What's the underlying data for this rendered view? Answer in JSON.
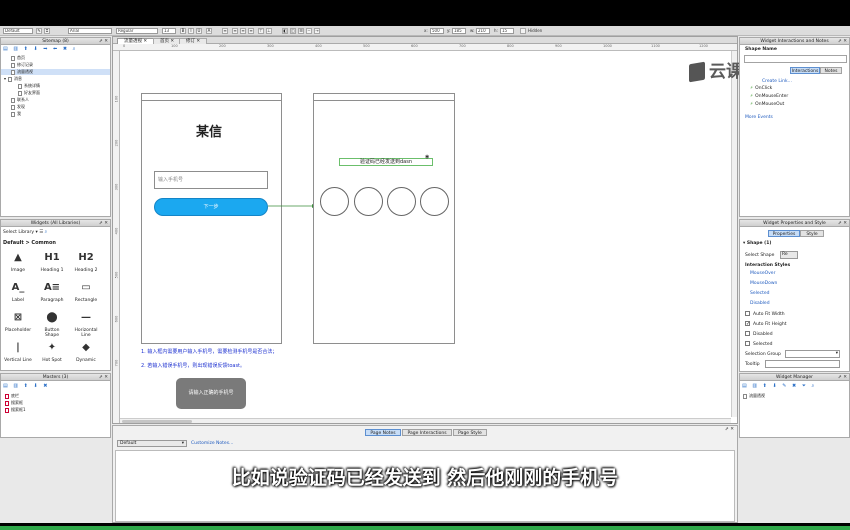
{
  "toolbar": {
    "style_select": "Default",
    "font_select": "Arial",
    "weight_select": "Regular",
    "size_select": "13",
    "x_label": "x:",
    "x_value": "500",
    "y_label": "y:",
    "y_value": "185",
    "w_label": "w:",
    "w_value": "210",
    "h_label": "h:",
    "h_value": "15",
    "hidden_label": "Hidden"
  },
  "sitemap": {
    "title": "Sitemap (8)",
    "items": [
      {
        "label": "首页",
        "indent": 1
      },
      {
        "label": "修订记录",
        "indent": 1
      },
      {
        "label": "流量透视",
        "indent": 1,
        "selected": true
      },
      {
        "label": "消息",
        "indent": 0
      },
      {
        "label": "系统详情",
        "indent": 2
      },
      {
        "label": "好友界面",
        "indent": 2
      },
      {
        "label": "联系人",
        "indent": 1
      },
      {
        "label": "发现",
        "indent": 1
      },
      {
        "label": "我",
        "indent": 1
      }
    ]
  },
  "widgets": {
    "title": "Widgets (All Libraries)",
    "select_library": "Select Library",
    "group_title": "Default > Common",
    "items": [
      {
        "label": "Image",
        "glyph": "▲"
      },
      {
        "label": "Heading 1",
        "glyph": "H1"
      },
      {
        "label": "Heading 2",
        "glyph": "H2"
      },
      {
        "label": "Label",
        "glyph": "A_"
      },
      {
        "label": "Paragraph",
        "glyph": "A≡"
      },
      {
        "label": "Rectangle",
        "glyph": "▭"
      },
      {
        "label": "Placeholder",
        "glyph": "⊠"
      },
      {
        "label": "Button Shape",
        "glyph": "⬤"
      },
      {
        "label": "Horizontal Line",
        "glyph": "—"
      },
      {
        "label": "Vertical Line",
        "glyph": "|"
      },
      {
        "label": "Hot Spot",
        "glyph": "✦"
      },
      {
        "label": "Dynamic",
        "glyph": "◆"
      }
    ]
  },
  "masters": {
    "title": "Masters (3)",
    "items": [
      "底栏",
      "搜索框",
      "搜索框1"
    ]
  },
  "tabs": {
    "active_page": "流量透视",
    "page2": "首页",
    "page3": "修订"
  },
  "ruler_ticks": [
    "0",
    "100",
    "200",
    "300",
    "400",
    "500",
    "600",
    "700",
    "800",
    "900",
    "1000",
    "1100",
    "1200"
  ],
  "ruler_v_ticks": [
    "100",
    "200",
    "300",
    "400",
    "500",
    "600",
    "700"
  ],
  "canvas": {
    "app_title": "某信",
    "phone_input_placeholder": "输入手机号",
    "next_button": "下一步",
    "verify_sent": "验证码已经发送到dasn",
    "note_line1": "1. 输入框内需要用户输入手机号，需要检测手机号是否合法；",
    "note_line2": "2. 若输入错误手机号，则出现错误反馈toast。",
    "toast_text": "请输入正确的手机号",
    "accent_color": "#1ba8f0"
  },
  "right_interactions": {
    "title": "Widget Interactions and Notes",
    "shape_name": "Shape Name",
    "tab_interactions": "Interactions",
    "tab_notes": "Notes",
    "create_link": "Create Link...",
    "events": [
      "OnClick",
      "OnMouseEnter",
      "OnMouseOut"
    ],
    "more_events": "More Events"
  },
  "right_properties": {
    "title": "Widget Properties and Style",
    "tab_properties": "Properties",
    "tab_style": "Style",
    "shape_header": "Shape (1)",
    "select_shape_label": "Select Shape",
    "select_shape_value": "Re",
    "interaction_styles": "Interaction Styles",
    "styles": [
      "MouseOver",
      "MouseDown",
      "Selected",
      "Disabled"
    ],
    "auto_fit_width": "Auto Fit Width",
    "auto_fit_height": "Auto Fit Height",
    "disabled": "Disabled",
    "selected": "Selected",
    "selection_group": "Selection Group",
    "tooltip": "Tooltip"
  },
  "widget_manager": {
    "title": "Widget Manager",
    "item": "流量透视"
  },
  "bottom": {
    "tab_notes": "Page Notes",
    "tab_interactions": "Page Interactions",
    "tab_style": "Page Style",
    "select_value": "Default",
    "customize_link": "Customize Notes..."
  },
  "watermark": "云课堂",
  "subtitle": "比如说验证码已经发送到 然后他刚刚的手机号"
}
